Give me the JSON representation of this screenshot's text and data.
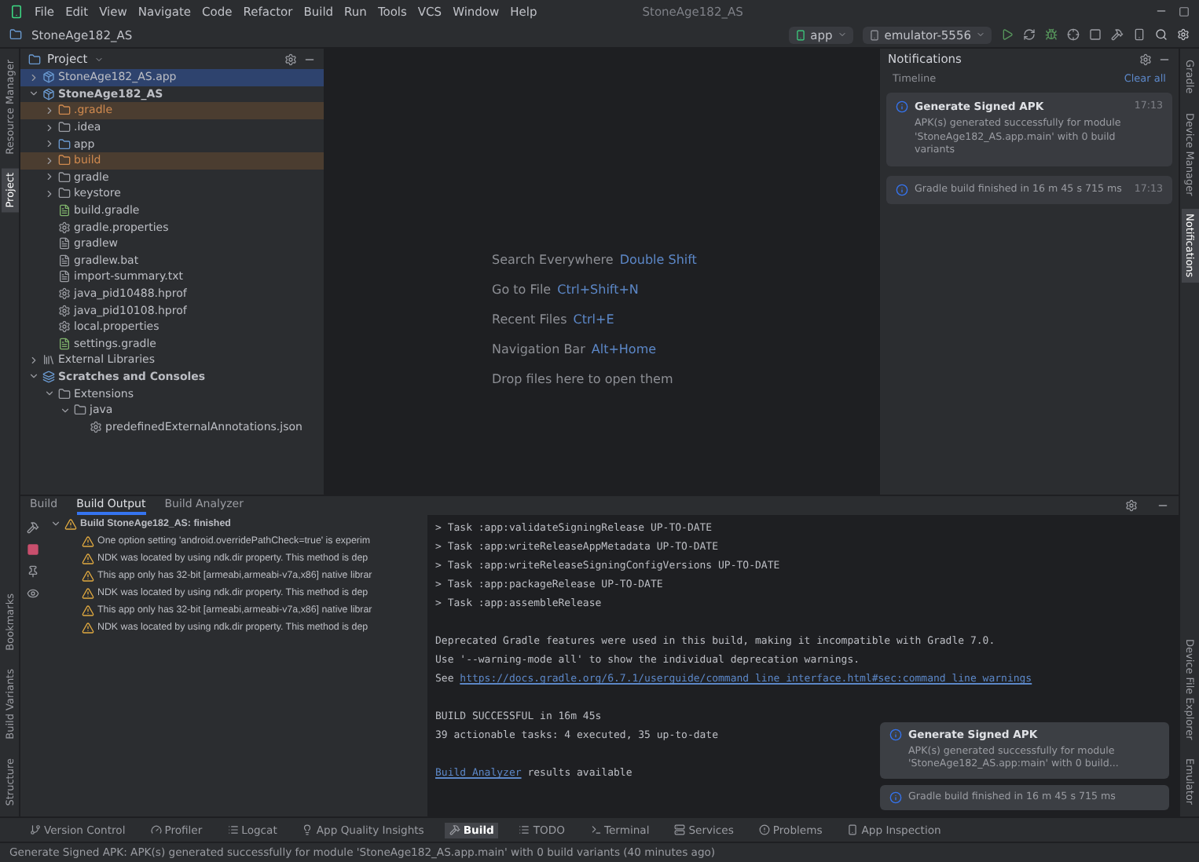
{
  "title_bar": {
    "menu": [
      "File",
      "Edit",
      "View",
      "Navigate",
      "Code",
      "Refactor",
      "Build",
      "Run",
      "Tools",
      "VCS",
      "Window",
      "Help"
    ],
    "title": "StoneAge182_AS"
  },
  "nav_bar": {
    "project": "StoneAge182_AS",
    "run_config": "app",
    "device": "emulator-5556"
  },
  "left_stripe": {
    "top": [
      {
        "label": "Resource Manager",
        "selected": false
      },
      {
        "label": "Project",
        "selected": true
      }
    ],
    "bottom": [
      {
        "label": "Bookmarks",
        "selected": false
      },
      {
        "label": "Build Variants",
        "selected": false
      },
      {
        "label": "Structure",
        "selected": false
      }
    ]
  },
  "project_panel": {
    "title": "Project",
    "tree": [
      {
        "label": "StoneAge182_AS.app",
        "kind": "module",
        "expanded": false,
        "selected": true,
        "excluded": false
      },
      {
        "label": "StoneAge182_AS",
        "kind": "module",
        "expanded": true,
        "selected": false,
        "excluded": false,
        "children": [
          {
            "label": ".gradle",
            "kind": "folder",
            "expanded": false,
            "selected": false,
            "excluded": true
          },
          {
            "label": ".idea",
            "kind": "folder",
            "expanded": false,
            "selected": false,
            "excluded": false
          },
          {
            "label": "app",
            "kind": "module-folder",
            "expanded": false,
            "selected": false,
            "excluded": false
          },
          {
            "label": "build",
            "kind": "folder",
            "expanded": false,
            "selected": false,
            "excluded": true
          },
          {
            "label": "gradle",
            "kind": "folder",
            "expanded": false,
            "selected": false,
            "excluded": false
          },
          {
            "label": "keystore",
            "kind": "folder",
            "expanded": false,
            "selected": false,
            "excluded": false
          },
          {
            "label": "build.gradle",
            "kind": "gradle-file",
            "selected": false,
            "excluded": false
          },
          {
            "label": "gradle.properties",
            "kind": "settings-file",
            "selected": false,
            "excluded": false
          },
          {
            "label": "gradlew",
            "kind": "file",
            "selected": false,
            "excluded": false
          },
          {
            "label": "gradlew.bat",
            "kind": "file",
            "selected": false,
            "excluded": false
          },
          {
            "label": "import-summary.txt",
            "kind": "file",
            "selected": false,
            "excluded": false
          },
          {
            "label": "java_pid10488.hprof",
            "kind": "settings-file",
            "selected": false,
            "excluded": false
          },
          {
            "label": "java_pid10108.hprof",
            "kind": "settings-file",
            "selected": false,
            "excluded": false
          },
          {
            "label": "local.properties",
            "kind": "settings-file",
            "selected": false,
            "excluded": false
          },
          {
            "label": "settings.gradle",
            "kind": "gradle-file",
            "selected": false,
            "excluded": false
          }
        ]
      },
      {
        "label": "External Libraries",
        "kind": "library",
        "expanded": false,
        "selected": false,
        "excluded": false
      },
      {
        "label": "Scratches and Consoles",
        "kind": "scratch",
        "expanded": true,
        "selected": false,
        "excluded": false,
        "children": [
          {
            "label": "Extensions",
            "kind": "folder",
            "expanded": true,
            "selected": false,
            "excluded": false,
            "children": [
              {
                "label": "java",
                "kind": "folder",
                "expanded": true,
                "selected": false,
                "excluded": false,
                "children": [
                  {
                    "label": "predefinedExternalAnnotations.json",
                    "kind": "settings-file",
                    "selected": false,
                    "excluded": false
                  }
                ]
              }
            ]
          }
        ]
      }
    ]
  },
  "editor_hints": [
    {
      "action": "Search Everywhere",
      "shortcut": "Double Shift"
    },
    {
      "action": "Go to File",
      "shortcut": "Ctrl+Shift+N"
    },
    {
      "action": "Recent Files",
      "shortcut": "Ctrl+E"
    },
    {
      "action": "Navigation Bar",
      "shortcut": "Alt+Home"
    },
    {
      "action": "Drop files here to open them"
    }
  ],
  "notifications": {
    "title": "Notifications",
    "section": "Timeline",
    "clear": "Clear all",
    "items": [
      {
        "title": "Generate Signed APK",
        "body": "APK(s) generated successfully for module 'StoneAge182_AS.app.main' with 0 build variants",
        "time": "17:13"
      },
      {
        "body": "Gradle build finished in 16 m 45 s 715 ms",
        "time": "17:13"
      }
    ]
  },
  "right_stripe": {
    "top": [
      {
        "label": "Gradle",
        "selected": false
      },
      {
        "label": "Device Manager",
        "selected": false
      },
      {
        "label": "Notifications",
        "selected": true
      }
    ],
    "bottom": [
      {
        "label": "Device File Explorer",
        "selected": false
      },
      {
        "label": "Emulator",
        "selected": false
      }
    ]
  },
  "bottom_panel": {
    "tabs": [
      {
        "label": "Build",
        "selected": false
      },
      {
        "label": "Build Output",
        "selected": true
      },
      {
        "label": "Build Analyzer",
        "selected": false
      }
    ],
    "build_tree": {
      "label": "Build StoneAge182_AS: finished",
      "expanded": true,
      "children": [
        "One option setting 'android.overridePathCheck=true' is experim",
        "NDK was located by using ndk.dir property. This method is dep",
        "This app only has 32-bit [armeabi,armeabi-v7a,x86] native librar",
        "NDK was located by using ndk.dir property. This method is dep",
        "This app only has 32-bit [armeabi,armeabi-v7a,x86] native librar",
        "NDK was located by using ndk.dir property. This method is dep"
      ]
    },
    "console": [
      {
        "kind": "text",
        "text": "> Task :app:validateSigningRelease UP-TO-DATE"
      },
      {
        "kind": "text",
        "text": "> Task :app:writeReleaseAppMetadata UP-TO-DATE"
      },
      {
        "kind": "text",
        "text": "> Task :app:writeReleaseSigningConfigVersions UP-TO-DATE"
      },
      {
        "kind": "text",
        "text": "> Task :app:packageRelease UP-TO-DATE"
      },
      {
        "kind": "text",
        "text": "> Task :app:assembleRelease"
      },
      {
        "kind": "blank"
      },
      {
        "kind": "text",
        "text": "Deprecated Gradle features were used in this build, making it incompatible with Gradle 7.0."
      },
      {
        "kind": "text",
        "text": "Use '--warning-mode all' to show the individual deprecation warnings."
      },
      {
        "kind": "link",
        "prefix": "See ",
        "link": "https://docs.gradle.org/6.7.1/userguide/command_line_interface.html#sec:command_line_warnings"
      },
      {
        "kind": "blank"
      },
      {
        "kind": "text",
        "text": "BUILD SUCCESSFUL in 16m 45s"
      },
      {
        "kind": "text",
        "text": "39 actionable tasks: 4 executed, 35 up-to-date"
      },
      {
        "kind": "blank"
      },
      {
        "kind": "link-first",
        "link": "Build Analyzer",
        "suffix": " results available"
      }
    ],
    "toasts": [
      {
        "title": "Generate Signed APK",
        "body": "APK(s) generated successfully for module 'StoneAge182_AS.app:main' with 0 build..."
      },
      {
        "body": "Gradle build finished in 16 m 45 s 715 ms"
      }
    ]
  },
  "tool_bar": [
    {
      "label": "Version Control",
      "selected": false
    },
    {
      "label": "Profiler",
      "selected": false
    },
    {
      "label": "Logcat",
      "selected": false
    },
    {
      "label": "App Quality Insights",
      "selected": false
    },
    {
      "label": "Build",
      "selected": true
    },
    {
      "label": "TODO",
      "selected": false
    },
    {
      "label": "Terminal",
      "selected": false
    },
    {
      "label": "Services",
      "selected": false
    },
    {
      "label": "Problems",
      "selected": false
    },
    {
      "label": "App Inspection",
      "selected": false
    }
  ],
  "status_bar": {
    "message": "Generate Signed APK: APK(s) generated successfully for module 'StoneAge182_AS.app.main' with 0 build variants (40 minutes ago)"
  }
}
